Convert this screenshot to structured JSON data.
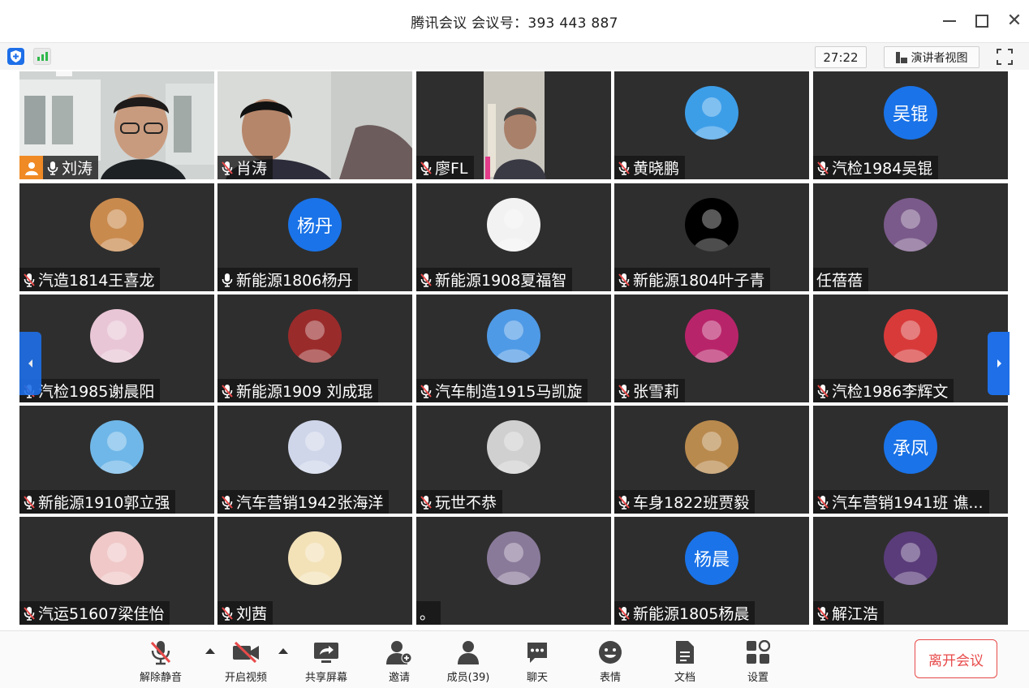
{
  "window": {
    "title": "腾讯会议 会议号：393 443 887"
  },
  "topbar": {
    "timer": "27:22",
    "speaker_view_label": "演讲者视图"
  },
  "colors": {
    "accent": "#1e6fe8",
    "tile_bg": "#2e2e2e",
    "leave_red": "#e84a4a",
    "host_orange": "#f08a24",
    "signal_green": "#2fb84b"
  },
  "participants": [
    {
      "name": "刘涛",
      "type": "video",
      "mic": "on",
      "host": true
    },
    {
      "name": "肖涛",
      "type": "video",
      "mic": "muted"
    },
    {
      "name": "廖FL",
      "type": "video",
      "mic": "muted"
    },
    {
      "name": "黄晓鹏",
      "type": "photo",
      "mic": "muted",
      "color": "#3d9ee8"
    },
    {
      "name": "汽检1984吴锟",
      "type": "initials",
      "initials": "吴锟",
      "mic": "muted",
      "color": "#1a73e8"
    },
    {
      "name": "汽造1814王喜龙",
      "type": "photo",
      "mic": "muted",
      "color": "#c98a4e"
    },
    {
      "name": "新能源1806杨丹",
      "type": "initials",
      "initials": "杨丹",
      "mic": "on",
      "color": "#1a73e8"
    },
    {
      "name": "新能源1908夏福智",
      "type": "photo",
      "mic": "muted",
      "color": "#f2f2f2"
    },
    {
      "name": "新能源1804叶子青",
      "type": "photo",
      "mic": "muted",
      "color": "#000000"
    },
    {
      "name": "任蓓蓓",
      "type": "photo",
      "mic": "none",
      "color": "#7a5a8a"
    },
    {
      "name": "汽检1985谢晨阳",
      "type": "photo",
      "mic": "muted",
      "color": "#e9c6d6"
    },
    {
      "name": "新能源1909 刘成琨",
      "type": "photo",
      "mic": "muted",
      "color": "#9a2b2b"
    },
    {
      "name": "汽车制造1915马凯旋",
      "type": "photo",
      "mic": "muted",
      "color": "#4f9ae6"
    },
    {
      "name": "张雪莉",
      "type": "photo",
      "mic": "muted",
      "color": "#b8246a"
    },
    {
      "name": "汽检1986李辉文",
      "type": "photo",
      "mic": "muted",
      "color": "#d83a3a"
    },
    {
      "name": "新能源1910郭立强",
      "type": "photo",
      "mic": "muted",
      "color": "#6fb7e8"
    },
    {
      "name": "汽车营销1942张海洋",
      "type": "photo",
      "mic": "muted",
      "color": "#cfd6ea"
    },
    {
      "name": "玩世不恭",
      "type": "photo",
      "mic": "muted",
      "color": "#d0d0d0"
    },
    {
      "name": "车身1822班贾毅",
      "type": "photo",
      "mic": "muted",
      "color": "#b98a4e"
    },
    {
      "name": "汽车营销1941班  谯...",
      "type": "initials",
      "initials": "承凤",
      "mic": "muted",
      "color": "#1a73e8"
    },
    {
      "name": "汽运51607梁佳怡",
      "type": "photo",
      "mic": "muted",
      "color": "#f0c8c8"
    },
    {
      "name": "刘茜",
      "type": "photo",
      "mic": "muted",
      "color": "#f3e2b8"
    },
    {
      "name": "。",
      "type": "photo",
      "mic": "none",
      "color": "#8a7a9a"
    },
    {
      "name": "新能源1805杨晨",
      "type": "initials",
      "initials": "杨晨",
      "mic": "muted",
      "color": "#1a73e8"
    },
    {
      "name": "解江浩",
      "type": "photo",
      "mic": "muted",
      "color": "#5a3c7a"
    }
  ],
  "controls": [
    {
      "label": "解除静音",
      "icon": "mic-muted-icon"
    },
    {
      "label": "开启视频",
      "icon": "camera-off-icon"
    },
    {
      "label": "共享屏幕",
      "icon": "share-screen-icon"
    },
    {
      "label": "邀请",
      "icon": "invite-icon"
    },
    {
      "label": "成员(39)",
      "icon": "members-icon"
    },
    {
      "label": "聊天",
      "icon": "chat-icon"
    },
    {
      "label": "表情",
      "icon": "emoji-icon"
    },
    {
      "label": "文档",
      "icon": "document-icon"
    },
    {
      "label": "设置",
      "icon": "settings-icon"
    }
  ],
  "leave_label": "离开会议"
}
